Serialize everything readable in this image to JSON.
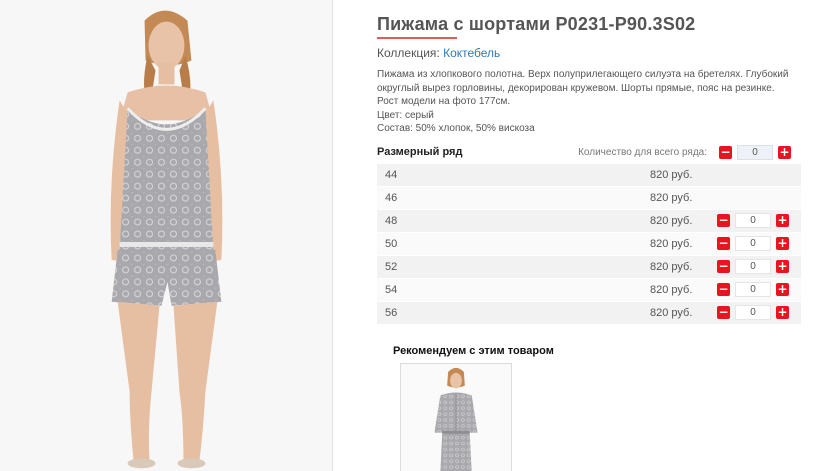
{
  "product": {
    "title": "Пижама с шортами P0231-P90.3S02",
    "collection_label": "Коллекция:",
    "collection_name": "Коктебель",
    "description": [
      "Пижама из хлопкового полотна. Верх полуприлегающего силуэта на бретелях. Глубокий округлый вырез горловины, декорирован кружевом. Шорты прямые, пояс на резинке.",
      "Рост модели на фото 177см.",
      "Цвет: серый",
      "Состав: 50% хлопок, 50% вискоза"
    ]
  },
  "size_table": {
    "header_label": "Размерный ряд",
    "qty_all_label": "Количество для всего ряда:",
    "qty_all_value": "0",
    "rows": [
      {
        "size": "44",
        "price": "820 руб.",
        "has_stepper": false
      },
      {
        "size": "46",
        "price": "820 руб.",
        "has_stepper": false
      },
      {
        "size": "48",
        "price": "820 руб.",
        "has_stepper": true,
        "qty": "0"
      },
      {
        "size": "50",
        "price": "820 руб.",
        "has_stepper": true,
        "qty": "0"
      },
      {
        "size": "52",
        "price": "820 руб.",
        "has_stepper": true,
        "qty": "0"
      },
      {
        "size": "54",
        "price": "820 руб.",
        "has_stepper": true,
        "qty": "0"
      },
      {
        "size": "56",
        "price": "820 руб.",
        "has_stepper": true,
        "qty": "0"
      }
    ]
  },
  "stepper": {
    "minus_glyph": "−",
    "plus_glyph": "+"
  },
  "recommend": {
    "title": "Рекомендуем с этим товаром"
  },
  "colors": {
    "accent": "#e8141f",
    "link": "#2a7abf",
    "title_underline": "#e45a5a"
  }
}
